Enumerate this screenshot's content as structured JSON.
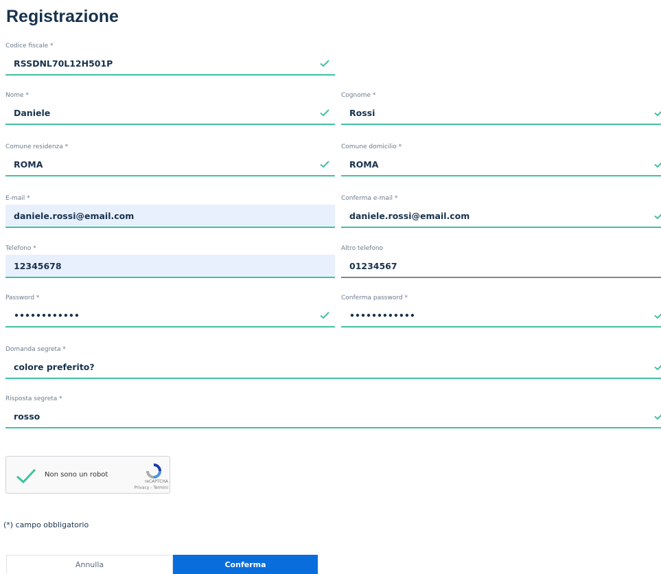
{
  "page": {
    "title": "Registrazione"
  },
  "fields": {
    "codice_fiscale": {
      "label": "Codice fiscale *",
      "value": "RSSDNL70L12H501P"
    },
    "nome": {
      "label": "Nome *",
      "value": "Daniele"
    },
    "cognome": {
      "label": "Cognome *",
      "value": "Rossi"
    },
    "comune_residenza": {
      "label": "Comune residenza *",
      "value": "ROMA"
    },
    "comune_domicilio": {
      "label": "Comune domicilio *",
      "value": "ROMA"
    },
    "email": {
      "label": "E-mail *",
      "value": "daniele.rossi@email.com"
    },
    "conferma_email": {
      "label": "Conferma e-mail *",
      "value": "daniele.rossi@email.com"
    },
    "telefono": {
      "label": "Telefono *",
      "value": "12345678"
    },
    "altro_telefono": {
      "label": "Altro telefono",
      "value": "01234567"
    },
    "password": {
      "label": "Password *",
      "value": "••••••••••••"
    },
    "conferma_password": {
      "label": "Conferma password *",
      "value": "••••••••••••"
    },
    "domanda_segreta": {
      "label": "Domanda segreta *",
      "value": "colore preferito?"
    },
    "risposta_segreta": {
      "label": "Risposta segreta *",
      "value": "rosso"
    }
  },
  "captcha": {
    "label": "Non sono un robot",
    "brand": "reCAPTCHA",
    "links": "Privacy - Termini"
  },
  "footer": {
    "required_note": "(*) campo obbligatorio",
    "cancel_label": "Annulla",
    "confirm_label": "Conferma"
  },
  "colors": {
    "valid": "#3ec2a0",
    "primary": "#0a6ddc",
    "title": "#17324d",
    "autofill": "#e8f0fd"
  },
  "icons": {
    "valid": "check-icon",
    "captcha": "recaptcha-logo-icon"
  }
}
